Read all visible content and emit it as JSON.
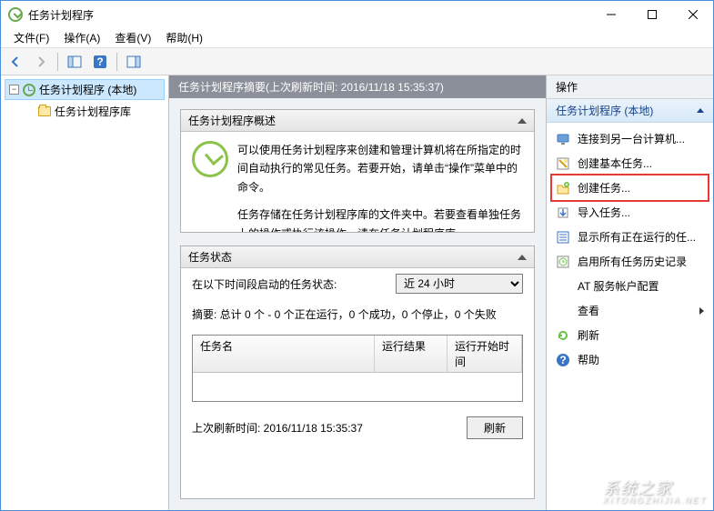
{
  "window": {
    "title": "任务计划程序"
  },
  "menubar": {
    "file": "文件(F)",
    "action": "操作(A)",
    "view": "查看(V)",
    "help": "帮助(H)"
  },
  "tree": {
    "root": "任务计划程序 (本地)",
    "library": "任务计划程序库"
  },
  "center": {
    "header": "任务计划程序摘要(上次刷新时间: 2016/11/18 15:35:37)",
    "overview_title": "任务计划程序概述",
    "overview_p1": "可以使用任务计划程序来创建和管理计算机将在所指定的时间自动执行的常见任务。若要开始，请单击“操作”菜单中的命令。",
    "overview_p2": "任务存储在任务计划程序库的文件夹中。若要查看单独任务上的操作或执行该操作，请在任务计划程序库",
    "status_title": "任务状态",
    "status_label": "在以下时间段启动的任务状态:",
    "status_select_value": "近 24 小时",
    "summary_line": "摘要: 总计 0 个 - 0 个正在运行，0 个成功，0 个停止，0 个失败",
    "table": {
      "col1": "任务名",
      "col2": "运行结果",
      "col3": "运行开始时间"
    },
    "last_refresh": "上次刷新时间: 2016/11/18 15:35:37",
    "refresh_btn": "刷新"
  },
  "actions": {
    "panel_title": "操作",
    "group_title": "任务计划程序 (本地)",
    "items": [
      {
        "label": "连接到另一台计算机...",
        "icon": "computer"
      },
      {
        "label": "创建基本任务...",
        "icon": "wizard"
      },
      {
        "label": "创建任务...",
        "icon": "folder-new",
        "highlighted": true
      },
      {
        "label": "导入任务...",
        "icon": "import"
      },
      {
        "label": "显示所有正在运行的任...",
        "icon": "list"
      },
      {
        "label": "启用所有任务历史记录",
        "icon": "history"
      },
      {
        "label": "AT 服务帐户配置",
        "icon": "blank"
      },
      {
        "label": "查看",
        "icon": "blank",
        "submenu": true
      },
      {
        "label": "刷新",
        "icon": "refresh"
      },
      {
        "label": "帮助",
        "icon": "help"
      }
    ]
  },
  "watermark": {
    "name": "系统之家",
    "sub": "XITONGZHIJIA.NET"
  }
}
